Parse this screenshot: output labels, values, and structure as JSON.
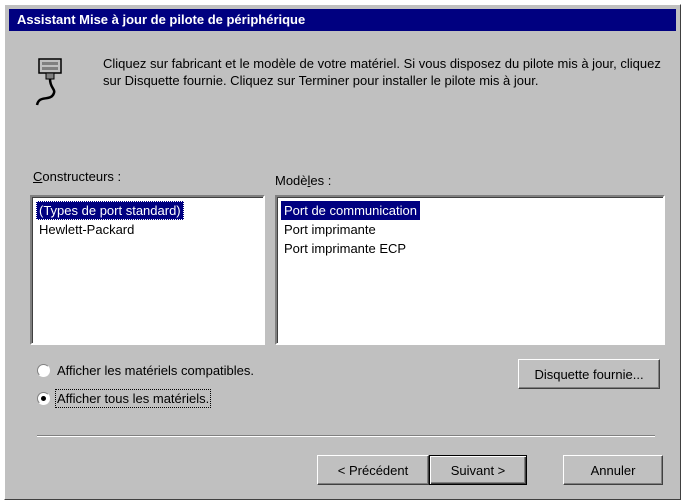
{
  "window": {
    "title": "Assistant Mise à jour de pilote de périphérique"
  },
  "header": {
    "icon": "port-connector-icon",
    "instructions": "Cliquez sur fabricant et le modèle de votre matériel. Si vous disposez du pilote mis à jour, cliquez sur Disquette fournie. Cliquez sur Terminer pour installer le pilote mis à jour."
  },
  "manufacturers": {
    "label": "Constructeurs :",
    "items": [
      "(Types de port standard)",
      "Hewlett-Packard"
    ],
    "selected": "(Types de port standard)"
  },
  "models": {
    "label": "Modèles :",
    "items": [
      "Port de communication",
      "Port imprimante",
      "Port imprimante ECP"
    ],
    "selected": "Port de communication"
  },
  "options": {
    "compatible": "Afficher les matériels compatibles.",
    "all": "Afficher tous les matériels.",
    "selected": "all"
  },
  "buttons": {
    "have_disk": "Disquette fournie...",
    "back": "< Précédent",
    "next": "Suivant >",
    "cancel": "Annuler"
  },
  "colors": {
    "titlebar": "#000080",
    "face": "#c0c0c0",
    "selection": "#000080"
  }
}
